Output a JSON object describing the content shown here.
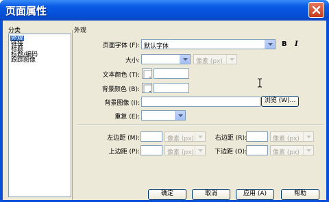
{
  "dialog": {
    "title": "页面属性"
  },
  "category": {
    "label": "分类",
    "items": [
      "外观",
      "链接",
      "标题",
      "标题/编码",
      "跟踪图像"
    ],
    "selected_index": 0
  },
  "section": {
    "label": "外观"
  },
  "appearance": {
    "font_label": "页面字体 (F):",
    "font_value": "默认字体",
    "bold": "B",
    "italic": "I",
    "size_label": "大小:",
    "size_value": "",
    "size_unit": "像素 (px)",
    "text_color_label": "文本颜色 (T):",
    "text_color_value": "",
    "bg_color_label": "背景颜色 (B):",
    "bg_color_value": "",
    "bg_image_label": "背景图像 (I):",
    "bg_image_value": "",
    "browse_label": "浏览 (W)...",
    "repeat_label": "重复 (E):",
    "repeat_value": ""
  },
  "margins": {
    "left_label": "左边距 (M):",
    "right_label": "右边距 (R):",
    "top_label": "上边距 (P):",
    "bottom_label": "下边距 (O):",
    "unit": "像素 (px)",
    "left_value": "",
    "right_value": "",
    "top_value": "",
    "bottom_value": ""
  },
  "buttons": {
    "ok": "确定",
    "cancel": "取消",
    "apply": "应用 (A)",
    "help": "帮助"
  },
  "colors": {
    "titlebar": "#0650d8",
    "dialog_bg": "#ece9d8",
    "selection": "#316ac5",
    "close": "#c43b1c"
  }
}
